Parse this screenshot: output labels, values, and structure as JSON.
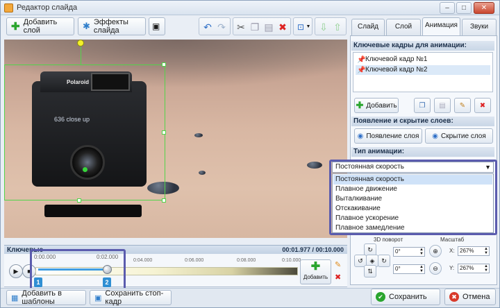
{
  "window": {
    "title": "Редактор слайда",
    "minimize": "–",
    "maximize": "□",
    "close": "✕"
  },
  "toolbar": {
    "add_layer": "Добавить слой",
    "slide_effects": "Эффекты слайда"
  },
  "stage": {
    "camera_brand": "Polaroid",
    "camera_label": "636 close up"
  },
  "timeline": {
    "label": "Ключевые",
    "time_display": "00:01.977 / 00:10.000",
    "ticks": [
      "0:00.000",
      "0:02.000",
      "0:04.000",
      "0:06.000",
      "0:08.000",
      "0:10.000"
    ],
    "markers": [
      "1",
      "2"
    ],
    "add_label": "Добавить",
    "position_fraction": 0.2
  },
  "bottom": {
    "add_templates": "Добавить в шаблоны",
    "save_frame": "Сохранить стоп-кадр",
    "save": "Сохранить",
    "cancel": "Отмена"
  },
  "tabs": [
    "Слайд",
    "Слой",
    "Анимация",
    "Звуки"
  ],
  "keyframes": {
    "header": "Ключевые кадры для анимации:",
    "items": [
      "Ключевой кадр №1",
      "Ключевой кадр №2"
    ],
    "add_label": "Добавить"
  },
  "appearance": {
    "header": "Появление и скрытие слоев:",
    "show_label": "Появление слоя",
    "hide_label": "Скрытие слоя"
  },
  "animation_type": {
    "header": "Тип анимации:",
    "selected": "Постоянная скорость",
    "options": [
      "Постоянная скорость",
      "Плавное движение",
      "Выталкивание",
      "Отскакивание",
      "Плавное ускорение",
      "Плавное замедление"
    ]
  },
  "transform": {
    "rotation_label": "3D поворот",
    "scale_label": "Масштаб",
    "rot_x": "0°",
    "rot_y": "0°",
    "scale_x_label": "X:",
    "scale_x": "267%",
    "scale_y_label": "Y:",
    "scale_y": "267%"
  },
  "colors": {
    "highlight": "#5b5cae",
    "accent": "#3f9de3"
  }
}
